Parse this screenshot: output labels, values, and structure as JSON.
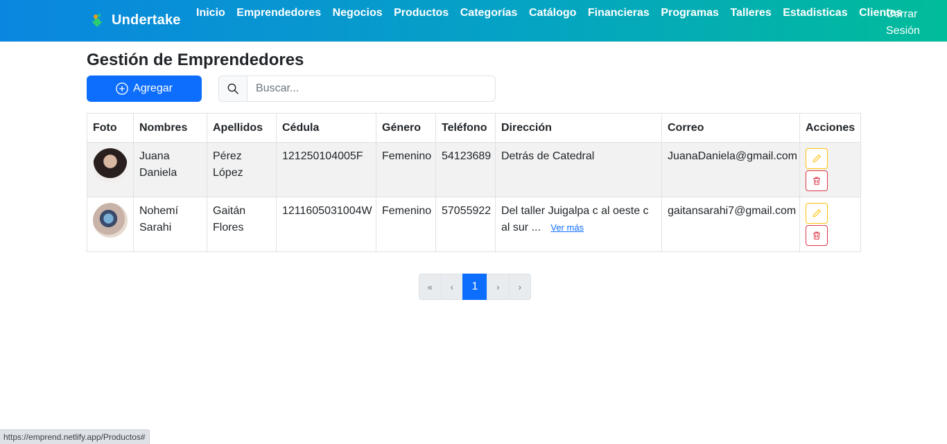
{
  "navbar": {
    "brand": "Undertake",
    "links": [
      "Inicio",
      "Emprendedores",
      "Negocios",
      "Productos",
      "Categorías",
      "Catálogo",
      "Financieras",
      "Programas",
      "Talleres",
      "Estadisticas",
      "Clientes"
    ],
    "logout": "Cerrar Sesión",
    "colors": {
      "gradient_start": "#0a86e0",
      "gradient_end": "#01bc9a"
    }
  },
  "page": {
    "title": "Gestión de Emprendedores"
  },
  "toolbar": {
    "add_label": "Agregar",
    "search_placeholder": "Buscar..."
  },
  "table": {
    "columns": [
      "Foto",
      "Nombres",
      "Apellidos",
      "Cédula",
      "Género",
      "Teléfono",
      "Dirección",
      "Correo",
      "Acciones"
    ],
    "rows": [
      {
        "nombres": "Juana Daniela",
        "apellidos": "Pérez López",
        "cedula": "121250104005F",
        "genero": "Femenino",
        "telefono": "54123689",
        "direccion": "Detrás de Catedral",
        "direccion_more": "",
        "correo": "JuanaDaniela@gmail.com"
      },
      {
        "nombres": "Nohemí Sarahi",
        "apellidos": "Gaitán Flores",
        "cedula": "121160503 1004W",
        "genero": "Femenino",
        "telefono": "57055922",
        "direccion": "Del taller Juigalpa c al oeste c al sur ...",
        "direccion_more": "Ver más",
        "correo": "gaitansarahi7@gmail.com"
      }
    ]
  },
  "pagination": {
    "first": "«",
    "prev": "‹",
    "current": "1",
    "next": "›",
    "last": "›"
  },
  "status_bar": {
    "url": "https://emprend.netlify.app/Productos#"
  },
  "colors": {
    "primary": "#0d6efd",
    "warning": "#ffc107",
    "danger": "#dc3545"
  }
}
